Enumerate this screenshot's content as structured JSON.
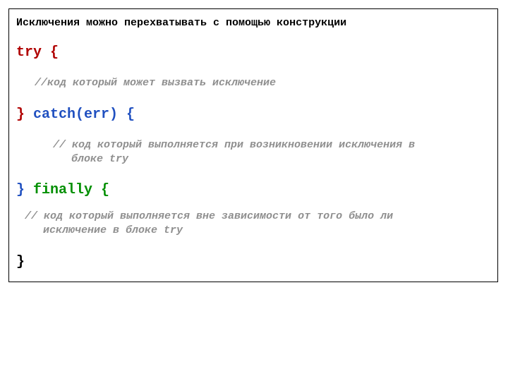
{
  "intro": "Исключения можно перехватывать с помощью конструкции",
  "try_open": "try {",
  "comment_try": "//код который может вызвать исключение",
  "catch_brace_close": "}",
  "catch_kw": " catch(err) {",
  "comment_catch_1": "//  код который выполняется при возникновении  исключения в",
  "comment_catch_2": "блоке try",
  "finally_brace_close": "}",
  "finally_kw": " finally {",
  "comment_finally_1": "// код который выполняется вне зависимости от того  было ли",
  "comment_finally_2": "исключение в блоке try",
  "final_brace": "}"
}
